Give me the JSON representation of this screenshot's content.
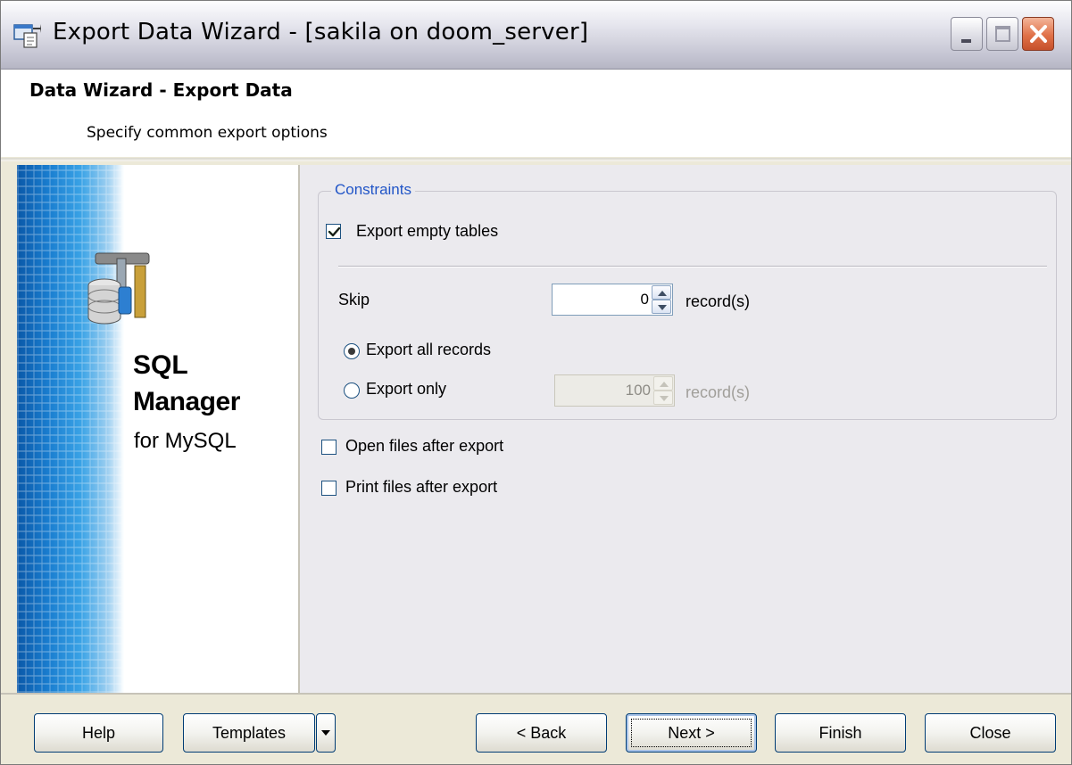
{
  "window": {
    "title": "Export Data Wizard - [sakila on doom_server]"
  },
  "header": {
    "title": "Data Wizard - Export Data",
    "subtitle": "Specify common export options"
  },
  "side_panel": {
    "product_line1": "SQL",
    "product_line2": "Manager",
    "product_line3": "for MySQL"
  },
  "constraints": {
    "legend": "Constraints",
    "export_empty_tables": {
      "label": "Export empty tables",
      "checked": true
    },
    "skip": {
      "label": "Skip",
      "value": "0",
      "unit": "record(s)"
    },
    "export_all_records": {
      "label": "Export all records",
      "selected": true
    },
    "export_only": {
      "label": "Export only",
      "selected": false,
      "value": "100",
      "unit": "record(s)",
      "enabled": false
    }
  },
  "options": {
    "open_files": {
      "label": "Open files after export",
      "checked": false
    },
    "print_files": {
      "label": "Print files after export",
      "checked": false
    }
  },
  "buttons": {
    "help": "Help",
    "templates": "Templates",
    "back": "< Back",
    "next": "Next >",
    "finish": "Finish",
    "close": "Close"
  }
}
